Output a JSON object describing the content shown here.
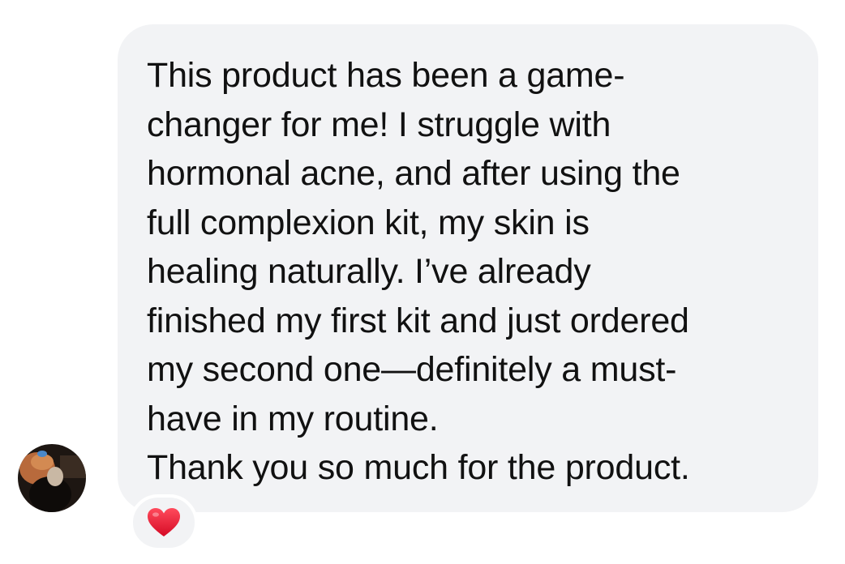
{
  "message": {
    "lines": [
      "This product has been a game-",
      "changer for me! I struggle with",
      "hormonal acne, and after using the",
      "full complexion kit, my skin is",
      "healing naturally. I’ve already",
      "finished my first kit and just ordered",
      "my second one—definitely a must-",
      "have in my routine.",
      "Thank you so much for the product."
    ]
  },
  "reaction": {
    "icon": "red-heart-icon"
  },
  "colors": {
    "bubble_bg": "#f2f3f5",
    "text": "#111111",
    "heart": "#e0102f"
  }
}
